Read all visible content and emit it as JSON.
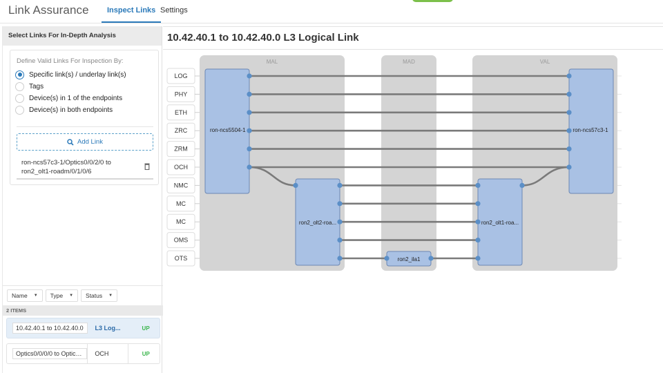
{
  "app": {
    "title": "Link Assurance"
  },
  "tabs": [
    {
      "label": "Inspect Links",
      "active": true
    },
    {
      "label": "Settings",
      "active": false
    }
  ],
  "colors": {
    "accent": "#2a79b9",
    "status_up": "#39b54a",
    "node_fill": "#a9c1e4",
    "domain_fill": "#d4d4d4",
    "green_button": "#7cc04b"
  },
  "sidebar": {
    "header": "Select Links For In-Depth Analysis",
    "define_title": "Define Valid Links For Inspection By:",
    "options": [
      {
        "label": "Specific link(s) / underlay link(s)",
        "checked": true
      },
      {
        "label": "Tags",
        "checked": false
      },
      {
        "label": "Device(s) in 1 of the endpoints",
        "checked": false
      },
      {
        "label": "Device(s) in both endpoints",
        "checked": false
      }
    ],
    "add_link_label": "Add Link",
    "add_link_icon": "search-icon",
    "selected_link": {
      "line1": "ron-ncs57c3-1/Optics0/0/2/0 to",
      "line2": "ron2_olt1-roadm/0/1/0/6",
      "remove_icon": "trash-icon"
    },
    "filters": [
      {
        "label": "Name"
      },
      {
        "label": "Type"
      },
      {
        "label": "Status"
      }
    ],
    "items_count": "2 ITEMS",
    "items": [
      {
        "name": "10.42.40.1 to 10.42.40.0",
        "type": "L3 Log...",
        "status": "UP",
        "selected": true
      },
      {
        "name": "Optics0/0/0/0 to Optics0...",
        "type": "OCH",
        "status": "UP",
        "selected": false
      }
    ]
  },
  "main": {
    "title": "10.42.40.1 to 10.42.40.0 L3 Logical Link",
    "layers": [
      "LOG",
      "PHY",
      "ETH",
      "ZRC",
      "ZRM",
      "OCH",
      "NMC",
      "MC",
      "MC",
      "OMS",
      "OTS"
    ],
    "domains": [
      {
        "label": "MAL"
      },
      {
        "label": "MAD"
      },
      {
        "label": "VAL"
      }
    ],
    "nodes": [
      {
        "label": "ron-ncs5504-1",
        "domain": "MAL",
        "layers": [
          "LOG",
          "PHY",
          "ETH",
          "ZRC",
          "ZRM",
          "OCH"
        ]
      },
      {
        "label": "ron2_olt2-roa...",
        "domain": "MAL",
        "layers": [
          "NMC",
          "MC",
          "MC",
          "OMS",
          "OTS"
        ]
      },
      {
        "label": "ron2_ila1",
        "domain": "MAD",
        "layers": [
          "OTS"
        ]
      },
      {
        "label": "ron2_olt1-roa...",
        "domain": "VAL",
        "layers": [
          "NMC",
          "MC",
          "MC",
          "OMS",
          "OTS"
        ]
      },
      {
        "label": "ron-ncs57c3-1",
        "domain": "VAL",
        "layers": [
          "LOG",
          "PHY",
          "ETH",
          "ZRC",
          "ZRM",
          "OCH"
        ]
      }
    ]
  }
}
